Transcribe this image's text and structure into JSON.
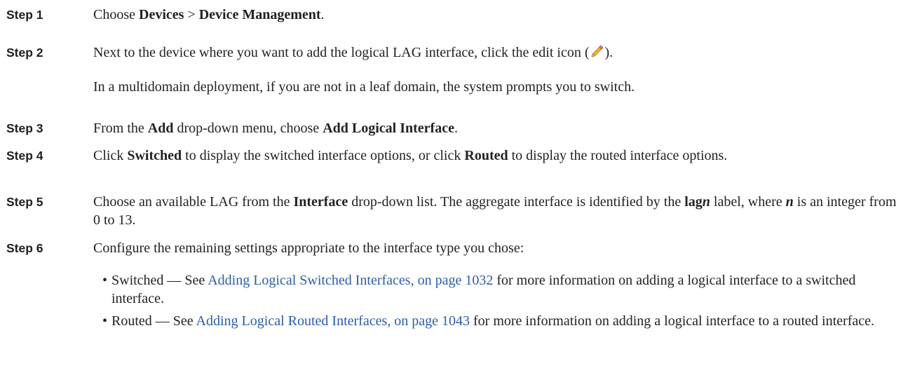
{
  "steps": [
    {
      "label": "Step 1",
      "parts": {
        "t0": "Choose ",
        "b0": "Devices",
        "t1": " > ",
        "b1": "Device Management",
        "t2": "."
      }
    },
    {
      "label": "Step 2",
      "parts": {
        "t0": "Next to the device where you want to add the logical LAG interface, click the edit icon (",
        "icon": "pencil-edit-icon",
        "t1": ")."
      },
      "note": "In a multidomain deployment, if you are not in a leaf domain, the system prompts you to switch."
    },
    {
      "label": "Step 3",
      "parts": {
        "t0": "From the ",
        "b0": "Add",
        "t1": " drop-down menu, choose ",
        "b1": "Add Logical Interface",
        "t2": "."
      }
    },
    {
      "label": "Step 4",
      "parts": {
        "t0": "Click ",
        "b0": "Switched",
        "t1": " to display the switched interface options, or click ",
        "b1": "Routed",
        "t2": " to display the routed interface options."
      }
    },
    {
      "label": "Step 5",
      "parts": {
        "t0": "Choose an available LAG from the ",
        "b0": "Interface",
        "t1": " drop-down list. The aggregate interface is identified by the ",
        "b1": "lag",
        "bi1": "n",
        "t2": " label, where ",
        "bi2": "n",
        "t3": " is an integer from 0 to 13."
      }
    },
    {
      "label": "Step 6",
      "parts": {
        "t0": "Configure the remaining settings appropriate to the interface type you chose:"
      },
      "bullets": [
        {
          "pre": "Switched — See ",
          "link": "Adding Logical Switched Interfaces, on page 1032",
          "post": " for more information on adding a logical interface to a switched interface."
        },
        {
          "pre": "Routed — See ",
          "link": "Adding Logical Routed Interfaces, on page 1043",
          "post": " for more information on adding a logical interface to a routed interface."
        }
      ]
    }
  ],
  "colors": {
    "link": "#2b5ea8",
    "text": "#222222"
  }
}
